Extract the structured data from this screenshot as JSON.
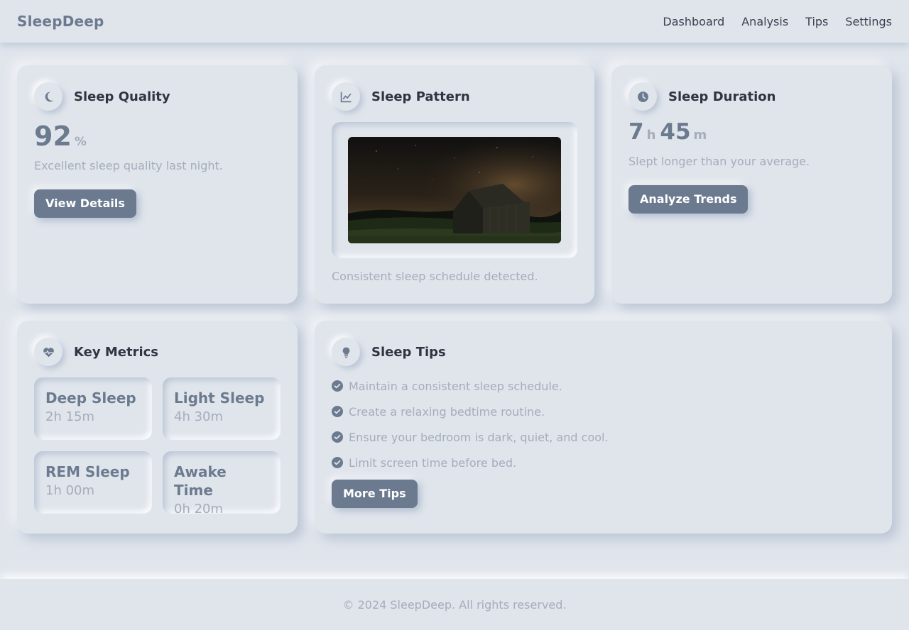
{
  "header": {
    "brand": "SleepDeep",
    "nav": [
      "Dashboard",
      "Analysis",
      "Tips",
      "Settings"
    ]
  },
  "sleep_quality": {
    "title": "Sleep Quality",
    "icon": "moon-icon",
    "value": "92",
    "unit": "%",
    "description": "Excellent sleep quality last night.",
    "button": "View Details"
  },
  "sleep_pattern": {
    "title": "Sleep Pattern",
    "icon": "chart-line-icon",
    "description": "Consistent sleep schedule detected."
  },
  "sleep_duration": {
    "title": "Sleep Duration",
    "icon": "clock-icon",
    "hours": "7",
    "hours_unit": "h",
    "minutes": "45",
    "minutes_unit": "m",
    "description": "Slept longer than your average.",
    "button": "Analyze Trends"
  },
  "key_metrics": {
    "title": "Key Metrics",
    "icon": "heart-pulse-icon",
    "items": [
      {
        "label": "Deep Sleep",
        "value": "2h 15m"
      },
      {
        "label": "Light Sleep",
        "value": "4h 30m"
      },
      {
        "label": "REM Sleep",
        "value": "1h 00m"
      },
      {
        "label": "Awake Time",
        "value": "0h 20m"
      }
    ]
  },
  "sleep_tips": {
    "title": "Sleep Tips",
    "icon": "lightbulb-icon",
    "tips": [
      "Maintain a consistent sleep schedule.",
      "Create a relaxing bedtime routine.",
      "Ensure your bedroom is dark, quiet, and cool.",
      "Limit screen time before bed."
    ],
    "button": "More Tips"
  },
  "footer": {
    "text": "© 2024 SleepDeep. All rights reserved."
  },
  "colors": {
    "background": "#e0e5ec",
    "accent": "#6b7a8f",
    "muted_text": "#a5adba",
    "heading_text": "#2f3440"
  }
}
